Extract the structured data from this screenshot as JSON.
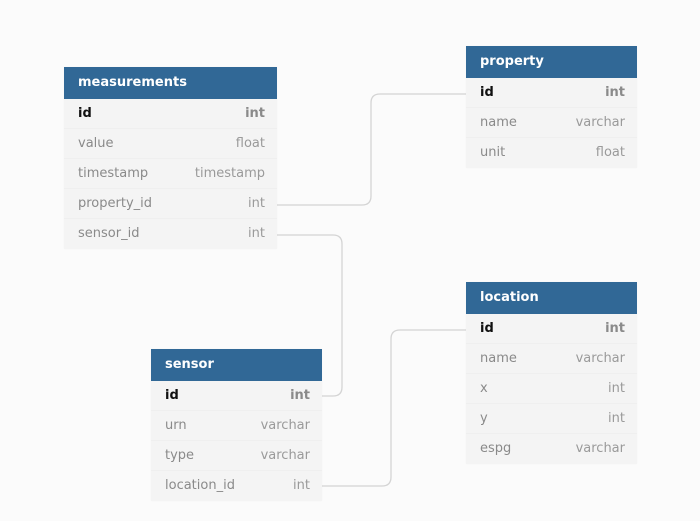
{
  "colors": {
    "header": "#316896",
    "header_text": "#ffffff",
    "body": "#f4f4f4",
    "link": "#d4d4d4",
    "background": "#fbfbfb"
  },
  "tables": {
    "measurements": {
      "name": "measurements",
      "fields": [
        {
          "name": "id",
          "type": "int",
          "pk": true
        },
        {
          "name": "value",
          "type": "float"
        },
        {
          "name": "timestamp",
          "type": "timestamp"
        },
        {
          "name": "property_id",
          "type": "int"
        },
        {
          "name": "sensor_id",
          "type": "int"
        }
      ]
    },
    "property": {
      "name": "property",
      "fields": [
        {
          "name": "id",
          "type": "int",
          "pk": true
        },
        {
          "name": "name",
          "type": "varchar"
        },
        {
          "name": "unit",
          "type": "float"
        }
      ]
    },
    "sensor": {
      "name": "sensor",
      "fields": [
        {
          "name": "id",
          "type": "int",
          "pk": true
        },
        {
          "name": "urn",
          "type": "varchar"
        },
        {
          "name": "type",
          "type": "varchar"
        },
        {
          "name": "location_id",
          "type": "int"
        }
      ]
    },
    "location": {
      "name": "location",
      "fields": [
        {
          "name": "id",
          "type": "int",
          "pk": true
        },
        {
          "name": "name",
          "type": "varchar"
        },
        {
          "name": "x",
          "type": "int"
        },
        {
          "name": "y",
          "type": "int"
        },
        {
          "name": "espg",
          "type": "varchar"
        }
      ]
    }
  },
  "relations": [
    {
      "from": "measurements.property_id",
      "to": "property.id"
    },
    {
      "from": "measurements.sensor_id",
      "to": "sensor.id"
    },
    {
      "from": "sensor.location_id",
      "to": "location.id"
    }
  ]
}
